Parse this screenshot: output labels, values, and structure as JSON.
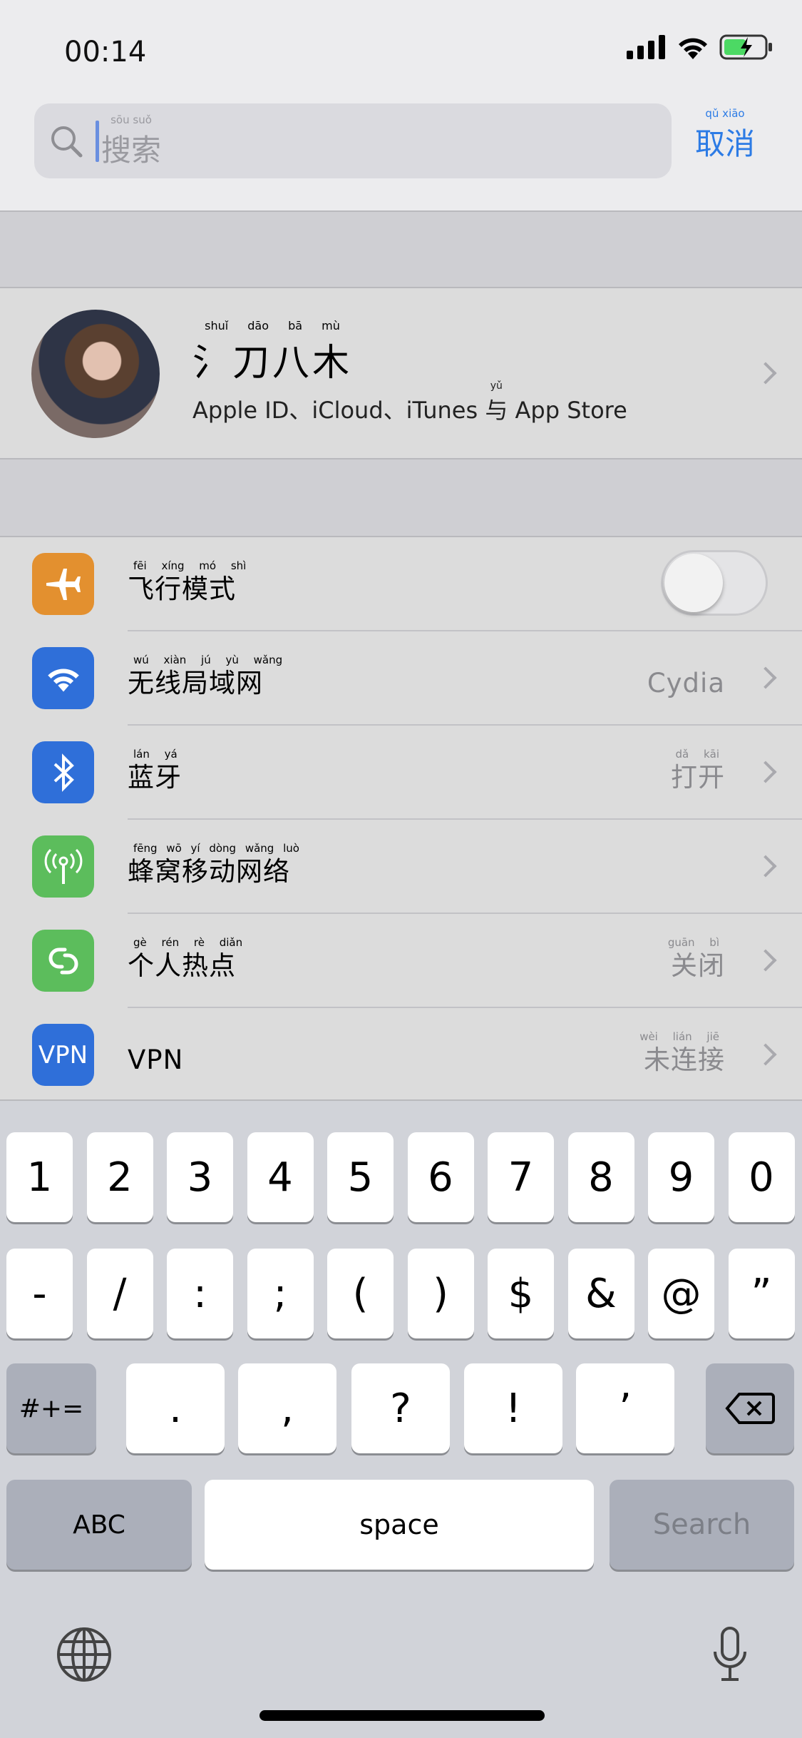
{
  "status_bar": {
    "time": "00:14",
    "icons": [
      "cellular-signal-icon",
      "wifi-icon",
      "battery-charging-icon"
    ],
    "battery_color": "#4cd964"
  },
  "search": {
    "placeholder": "搜索",
    "placeholder_pinyin": "sōu suǒ",
    "cancel": "取消",
    "cancel_pinyin": "qǔ xiāo",
    "accent": "#2c7be5"
  },
  "profile": {
    "name": "氵刀八木",
    "name_pinyin": "shuǐ dāo bā mù",
    "subtitle_parts": [
      "Apple ID、iCloud、iTunes ",
      "与",
      " App Store"
    ],
    "subtitle_pinyin": "yǔ"
  },
  "settings": [
    {
      "label": "飞行模式",
      "pinyin": "fēi xíng mó shì",
      "icon": "airplane-icon",
      "color": "#e3902f",
      "toggle": false
    },
    {
      "label": "无线局域网",
      "pinyin": "wú xiàn jú yù wǎng",
      "icon": "wifi-icon",
      "color": "#2f6fd9",
      "value": "Cydia"
    },
    {
      "label": "蓝牙",
      "pinyin": "lán yá",
      "icon": "bluetooth-icon",
      "color": "#2f6fd9",
      "value": "打开",
      "value_pinyin": "dǎ kāi"
    },
    {
      "label": "蜂窝移动网络",
      "pinyin": "fēng wō yí dòng wǎng luò",
      "icon": "cellular-antenna-icon",
      "color": "#5cbd5c"
    },
    {
      "label": "个人热点",
      "pinyin": "gè rén rè diǎn",
      "icon": "hotspot-icon",
      "color": "#5cbd5c",
      "value": "关闭",
      "value_pinyin": "guān bì"
    },
    {
      "label": "VPN",
      "icon": "vpn-icon",
      "icon_text": "VPN",
      "color": "#2f6fd9",
      "value": "未连接",
      "value_pinyin": "wèi lián jiē"
    }
  ],
  "keyboard": {
    "row1": [
      "1",
      "2",
      "3",
      "4",
      "5",
      "6",
      "7",
      "8",
      "9",
      "0"
    ],
    "row2": [
      "-",
      "/",
      ":",
      ";",
      "(",
      ")",
      "$",
      "&",
      "@",
      "”"
    ],
    "row3": [
      ".",
      ",",
      "?",
      "!",
      "’"
    ],
    "mode_symbols": "#+=",
    "abc": "ABC",
    "space": "space",
    "search": "Search"
  }
}
